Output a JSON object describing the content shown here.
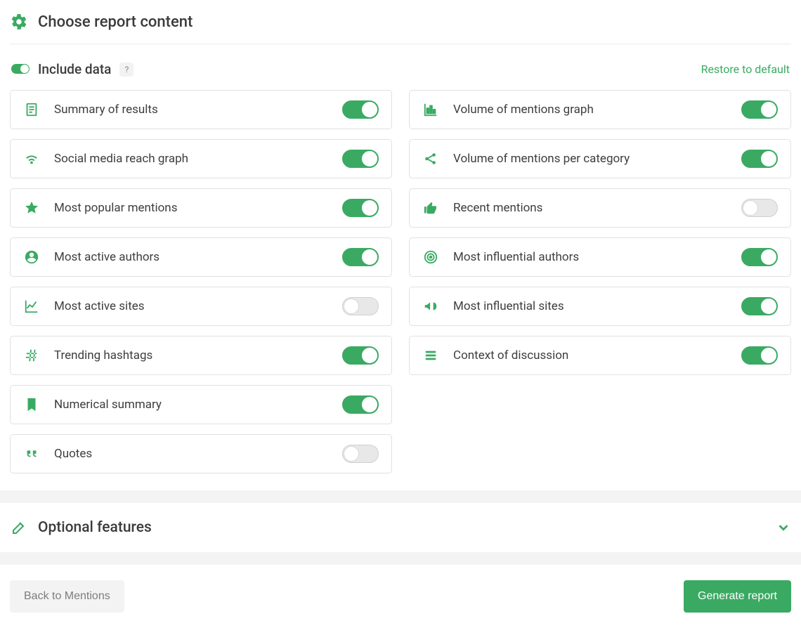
{
  "section_title": "Choose report content",
  "include_data": {
    "label": "Include data",
    "help": "?",
    "enabled": true
  },
  "restore_link": "Restore to default",
  "left_items": [
    {
      "icon": "document",
      "label": "Summary of results",
      "on": true
    },
    {
      "icon": "wifi",
      "label": "Social media reach graph",
      "on": true
    },
    {
      "icon": "star",
      "label": "Most popular mentions",
      "on": true
    },
    {
      "icon": "user-circle",
      "label": "Most active authors",
      "on": true
    },
    {
      "icon": "line-chart",
      "label": "Most active sites",
      "on": false
    },
    {
      "icon": "hashtag",
      "label": "Trending hashtags",
      "on": true
    },
    {
      "icon": "bookmark",
      "label": "Numerical summary",
      "on": true
    },
    {
      "icon": "quote",
      "label": "Quotes",
      "on": false
    }
  ],
  "right_items": [
    {
      "icon": "bar-chart",
      "label": "Volume of mentions graph",
      "on": true
    },
    {
      "icon": "share",
      "label": "Volume of mentions per category",
      "on": true
    },
    {
      "icon": "thumbs-up",
      "label": "Recent mentions",
      "on": false
    },
    {
      "icon": "target",
      "label": "Most influential authors",
      "on": true
    },
    {
      "icon": "bullhorn",
      "label": "Most influential sites",
      "on": true
    },
    {
      "icon": "list",
      "label": "Context of discussion",
      "on": true
    }
  ],
  "optional_features_title": "Optional features",
  "back_button": "Back to Mentions",
  "generate_button": "Generate report"
}
